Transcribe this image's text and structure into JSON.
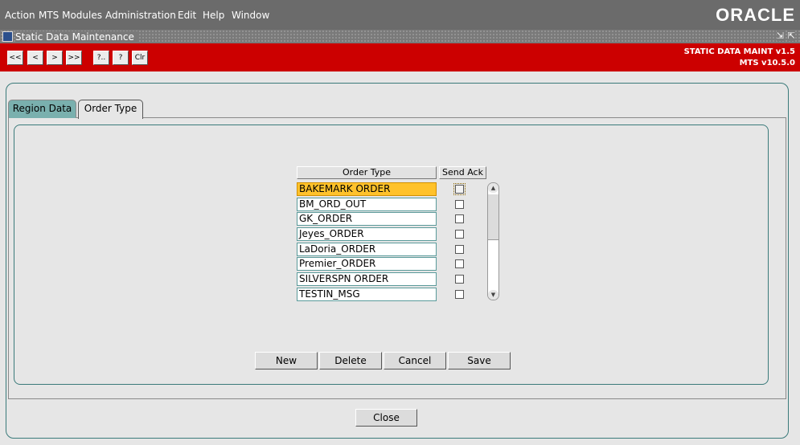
{
  "menu": {
    "items": [
      "Action",
      "MTS Modules",
      "Administration",
      "Edit",
      "Help",
      "Window"
    ],
    "brand": "ORACLE"
  },
  "window": {
    "title": "Static Data Maintenance",
    "controls": [
      "⇲",
      "⇱"
    ]
  },
  "toolbar": {
    "buttons": [
      "<<",
      "<",
      ">",
      ">>",
      "?..",
      "?",
      "Clr"
    ],
    "module_name": "STATIC DATA MAINT v1.5",
    "version": "MTS v10.5.0"
  },
  "tabs": [
    {
      "label": "Region Data",
      "active": false
    },
    {
      "label": "Order Type",
      "active": true
    }
  ],
  "grid": {
    "headers": [
      "Order Type",
      "Send Ack"
    ],
    "rows": [
      {
        "order_type": "BAKEMARK ORDER",
        "send_ack": false,
        "selected": true
      },
      {
        "order_type": "BM_ORD_OUT",
        "send_ack": false,
        "selected": false
      },
      {
        "order_type": "GK_ORDER",
        "send_ack": false,
        "selected": false
      },
      {
        "order_type": "Jeyes_ORDER",
        "send_ack": false,
        "selected": false
      },
      {
        "order_type": "LaDoria_ORDER",
        "send_ack": false,
        "selected": false
      },
      {
        "order_type": "Premier_ORDER",
        "send_ack": false,
        "selected": false
      },
      {
        "order_type": "SILVERSPN ORDER",
        "send_ack": false,
        "selected": false
      },
      {
        "order_type": "TESTIN_MSG",
        "send_ack": false,
        "selected": false
      }
    ]
  },
  "actions": {
    "new": "New",
    "delete": "Delete",
    "cancel": "Cancel",
    "save": "Save",
    "close": "Close"
  },
  "colors": {
    "toolbar": "#cc0000",
    "selected_row": "#ffc22b",
    "active_tab": "#7ab0ae",
    "frame_border": "#3a7a7a"
  }
}
